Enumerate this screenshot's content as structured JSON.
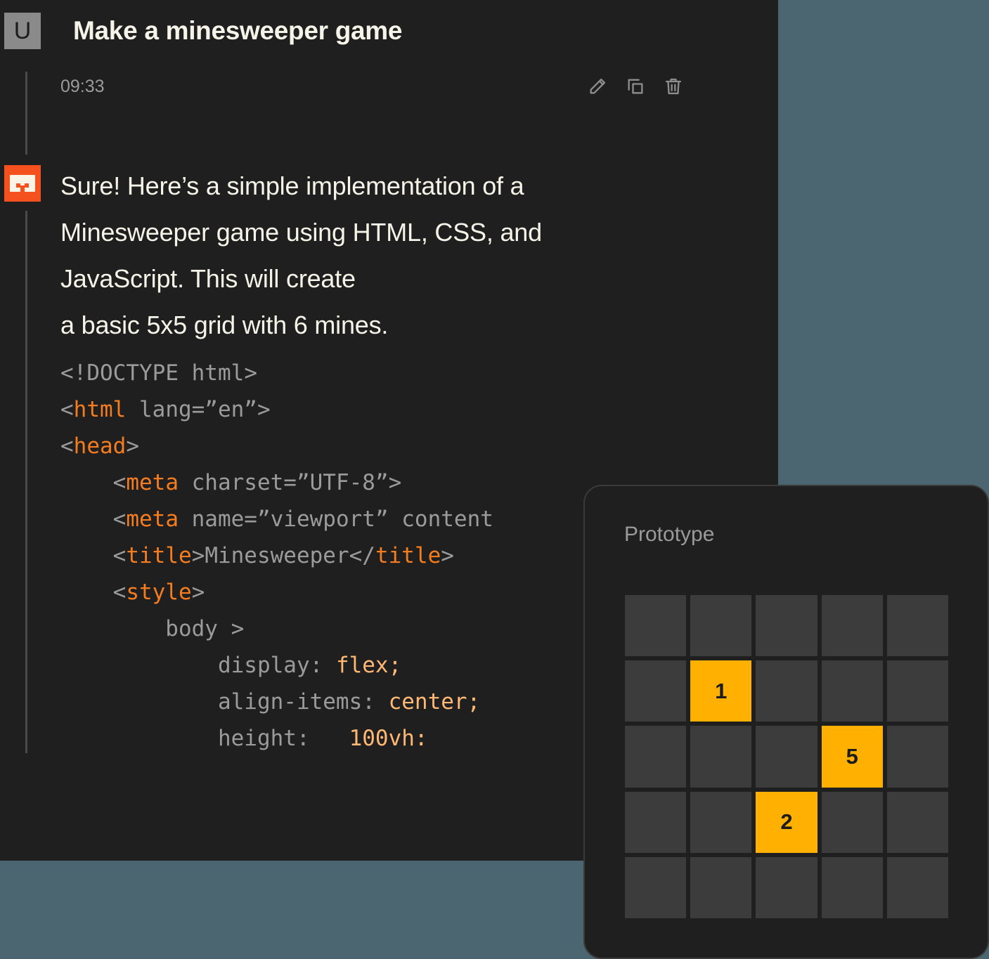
{
  "theme": {
    "page_background": "#4b6670",
    "panel_background": "#1f1f1f",
    "accent_orange": "#f4511e",
    "cell_amber": "#ffb000",
    "cell_default": "#3c3c3c",
    "text_primary": "#f6f3e8",
    "text_muted": "#9a9a9a",
    "code_tag": "#f57c1f",
    "code_value": "#ffb774",
    "code_plain": "#9b9b9b"
  },
  "chat": {
    "user_message": {
      "avatar_label": "U",
      "title": "Make a minesweeper game",
      "timestamp": "09:33",
      "actions": [
        {
          "name": "edit-icon",
          "label": "Edit"
        },
        {
          "name": "copy-icon",
          "label": "Copy"
        },
        {
          "name": "delete-icon",
          "label": "Delete"
        }
      ]
    },
    "assistant_message": {
      "avatar_icon": "minesweeper-mascot-icon",
      "lines": [
        "Sure! Here’s a simple implementation of a",
        "Minesweeper game using HTML, CSS, and",
        "JavaScript. This will create",
        "a basic 5x5 grid with 6 mines."
      ],
      "code": {
        "language": "html",
        "lines": [
          [
            {
              "t": "<",
              "c": "punct"
            },
            {
              "t": "!DOCTYPE html",
              "c": "plain"
            },
            {
              "t": ">",
              "c": "punct"
            }
          ],
          [
            {
              "t": "<",
              "c": "punct"
            },
            {
              "t": "html",
              "c": "tag"
            },
            {
              "t": " lang=”en”>",
              "c": "plain"
            }
          ],
          [
            {
              "t": "<",
              "c": "punct"
            },
            {
              "t": "head",
              "c": "tag"
            },
            {
              "t": ">",
              "c": "punct"
            }
          ],
          [
            {
              "t": "    <",
              "c": "punct"
            },
            {
              "t": "meta",
              "c": "tag"
            },
            {
              "t": " charset=”UTF-8”>",
              "c": "plain"
            }
          ],
          [
            {
              "t": "    <",
              "c": "punct"
            },
            {
              "t": "meta",
              "c": "tag"
            },
            {
              "t": " name=”viewport” content",
              "c": "plain"
            }
          ],
          [
            {
              "t": "    <",
              "c": "punct"
            },
            {
              "t": "title",
              "c": "tag"
            },
            {
              "t": ">Minesweeper</",
              "c": "plain"
            },
            {
              "t": "title",
              "c": "tag"
            },
            {
              "t": ">",
              "c": "punct"
            }
          ],
          [
            {
              "t": "    <",
              "c": "punct"
            },
            {
              "t": "style",
              "c": "tag"
            },
            {
              "t": ">",
              "c": "punct"
            }
          ],
          [
            {
              "t": "        body >",
              "c": "plain"
            }
          ],
          [
            {
              "t": "            display: ",
              "c": "plain"
            },
            {
              "t": "flex;",
              "c": "val"
            }
          ],
          [
            {
              "t": "            align-items: ",
              "c": "plain"
            },
            {
              "t": "center;",
              "c": "val"
            }
          ],
          [
            {
              "t": "            height:   ",
              "c": "plain"
            },
            {
              "t": "100vh:",
              "c": "val"
            }
          ]
        ]
      }
    }
  },
  "prototype": {
    "title": "Prototype",
    "grid": {
      "rows": 5,
      "columns": 5,
      "cells": [
        [
          "",
          "",
          "",
          "",
          ""
        ],
        [
          "",
          "1",
          "",
          "",
          ""
        ],
        [
          "",
          "",
          "",
          "5",
          ""
        ],
        [
          "",
          "",
          "2",
          "",
          ""
        ],
        [
          "",
          "",
          "",
          "",
          ""
        ]
      ]
    }
  }
}
